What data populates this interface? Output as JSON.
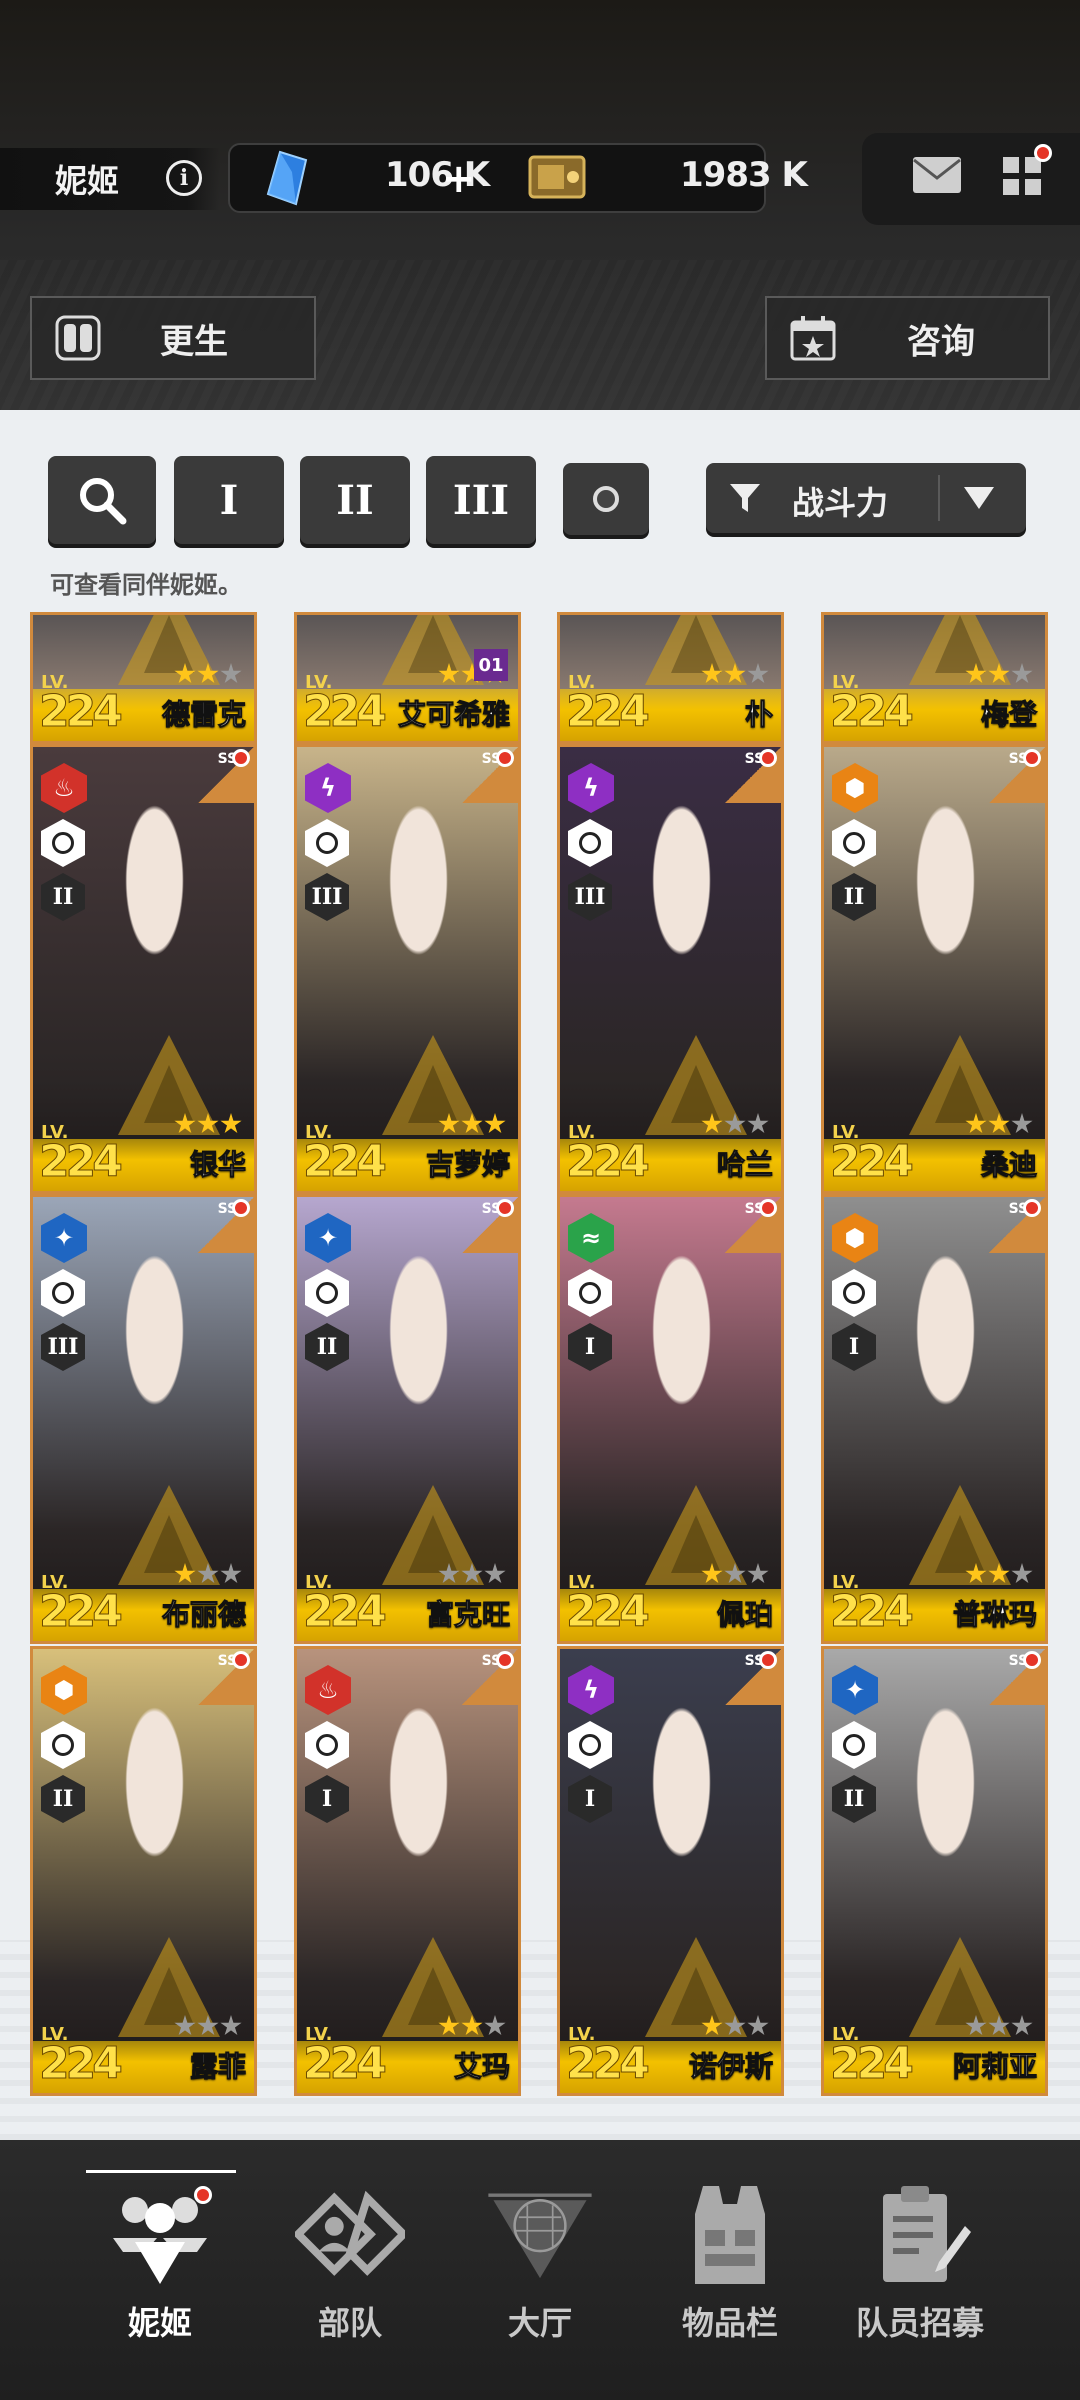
{
  "header": {
    "player_name": "妮姬",
    "gems": "106 K",
    "credits": "1983 K"
  },
  "top_buttons": {
    "rebirth": "更生",
    "consult": "咨询"
  },
  "filters": {
    "class_1": "I",
    "class_2": "II",
    "class_3": "III",
    "sort_label": "战斗力",
    "hint": "可查看同伴妮姬。"
  },
  "partial_row": [
    {
      "level": "224",
      "name": "德雷克",
      "stars": 3,
      "star_on": 2
    },
    {
      "level": "224",
      "name": "艾可希雅",
      "stars": 3,
      "star_on": 3,
      "tag": "01"
    },
    {
      "level": "224",
      "name": "朴",
      "stars": 3,
      "star_on": 2
    },
    {
      "level": "224",
      "name": "梅登",
      "stars": 3,
      "star_on": 2
    }
  ],
  "characters": [
    {
      "level": "224",
      "name": "银华",
      "element_color": "#d2322a",
      "element_icon": "fire-icon",
      "weapon": "sniper",
      "burst": "II",
      "star_on": 3,
      "bg": "#4a3b3d"
    },
    {
      "level": "224",
      "name": "吉萝婷",
      "element_color": "#8e2fc3",
      "element_icon": "electric-icon",
      "weapon": "assault",
      "burst": "III",
      "star_on": 3,
      "bg": "#c8b48a"
    },
    {
      "level": "224",
      "name": "哈兰",
      "element_color": "#8e2fc3",
      "element_icon": "electric-icon",
      "weapon": "sniper",
      "burst": "III",
      "star_on": 1,
      "bg": "#3a2d44"
    },
    {
      "level": "224",
      "name": "桑迪",
      "element_color": "#e98414",
      "element_icon": "iron-icon",
      "weapon": "shotgun",
      "burst": "II",
      "star_on": 2,
      "bg": "#b9a98a"
    },
    {
      "level": "224",
      "name": "布丽德",
      "element_color": "#1f66c2",
      "element_icon": "water-icon",
      "weapon": "launcher",
      "burst": "III",
      "star_on": 1,
      "bg": "#9ba6b8"
    },
    {
      "level": "224",
      "name": "富克旺",
      "element_color": "#1f66c2",
      "element_icon": "water-icon",
      "weapon": "launcher",
      "burst": "II",
      "star_on": 0,
      "bg": "#b6a7cf"
    },
    {
      "level": "224",
      "name": "佩珀",
      "element_color": "#2aa34a",
      "element_icon": "wind-icon",
      "weapon": "smg",
      "burst": "I",
      "star_on": 1,
      "bg": "#c57a8f"
    },
    {
      "level": "224",
      "name": "普琳玛",
      "element_color": "#e98414",
      "element_icon": "iron-icon",
      "weapon": "launcher",
      "burst": "I",
      "star_on": 2,
      "bg": "#8f8f8f"
    },
    {
      "level": "224",
      "name": "露菲",
      "element_color": "#e98414",
      "element_icon": "iron-icon",
      "weapon": "launcher",
      "burst": "II",
      "star_on": 0,
      "bg": "#d8c07b"
    },
    {
      "level": "224",
      "name": "艾玛",
      "element_color": "#d2322a",
      "element_icon": "fire-icon",
      "weapon": "assault",
      "burst": "I",
      "star_on": 2,
      "bg": "#b8937d"
    },
    {
      "level": "224",
      "name": "诺伊斯",
      "element_color": "#8e2fc3",
      "element_icon": "electric-icon",
      "weapon": "shotgun",
      "burst": "I",
      "star_on": 1,
      "bg": "#3b3e4e"
    },
    {
      "level": "224",
      "name": "阿莉亚",
      "element_color": "#1f66c2",
      "element_icon": "water-icon",
      "weapon": "assault",
      "burst": "II",
      "star_on": 0,
      "bg": "#a9a9a9"
    }
  ],
  "nav": {
    "nikke": "妮姬",
    "squad": "部队",
    "lobby": "大厅",
    "inventory": "物品栏",
    "recruit": "队员招募"
  },
  "common": {
    "lv_prefix": "LV.",
    "rarity": "SSR"
  }
}
